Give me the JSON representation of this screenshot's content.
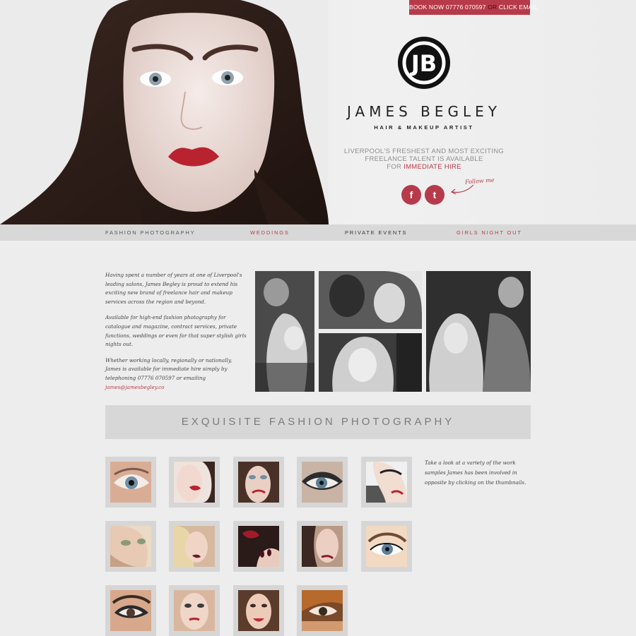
{
  "colors": {
    "accent": "#b73a4a",
    "background": "#ededed",
    "nav_bg": "#d8d8d8",
    "banner_bg": "#d7d7d7"
  },
  "booking": {
    "prefix": "BOOK NOW",
    "phone": "07776 070597",
    "or": "OR",
    "email_label": "CLICK EMAIL"
  },
  "brand": {
    "logo_text": "JB",
    "name": "JAMES BEGLEY",
    "subtitle": "HAIR & MAKEUP ARTIST",
    "tagline_line1": "LIVERPOOL'S FRESHEST AND MOST EXCITING",
    "tagline_line2": "FREELANCE TALENT IS AVAILABLE",
    "tagline_for": "FOR",
    "tagline_highlight": "IMMEDIATE HIRE"
  },
  "social": {
    "follow_text": "Follow me",
    "facebook_glyph": "f",
    "twitter_glyph": "t",
    "icons": [
      "facebook-icon",
      "twitter-icon"
    ]
  },
  "nav": {
    "items": [
      {
        "label": "FASHION PHOTOGRAPHY"
      },
      {
        "label": "WEDDINGS"
      },
      {
        "label": "PRIVATE EVENTS"
      },
      {
        "label": "GIRLS NIGHT OUT"
      }
    ]
  },
  "intro": {
    "p1": "Having spent a number of years at one of Liverpool's leading salons, James Begley is proud to extend his exciting new brand of freelance hair and makeup services across the region and beyond.",
    "p2": "Available for high-end fashion photography for catalogue and magazine, contract services, private functions, weddings or even for that super stylish girls nights out.",
    "p3": "Whether working locally, regionally or nationally, James is available for immediate hire simply by telephoning 07776 070597 or emailing",
    "email": "james@jamesbegley.co"
  },
  "section": {
    "banner": "EXQUISITE FASHION PHOTOGRAPHY",
    "side_note": "Take a look at a variety of the work samples James has been involved in opposite by clicking on the thumbnails."
  }
}
